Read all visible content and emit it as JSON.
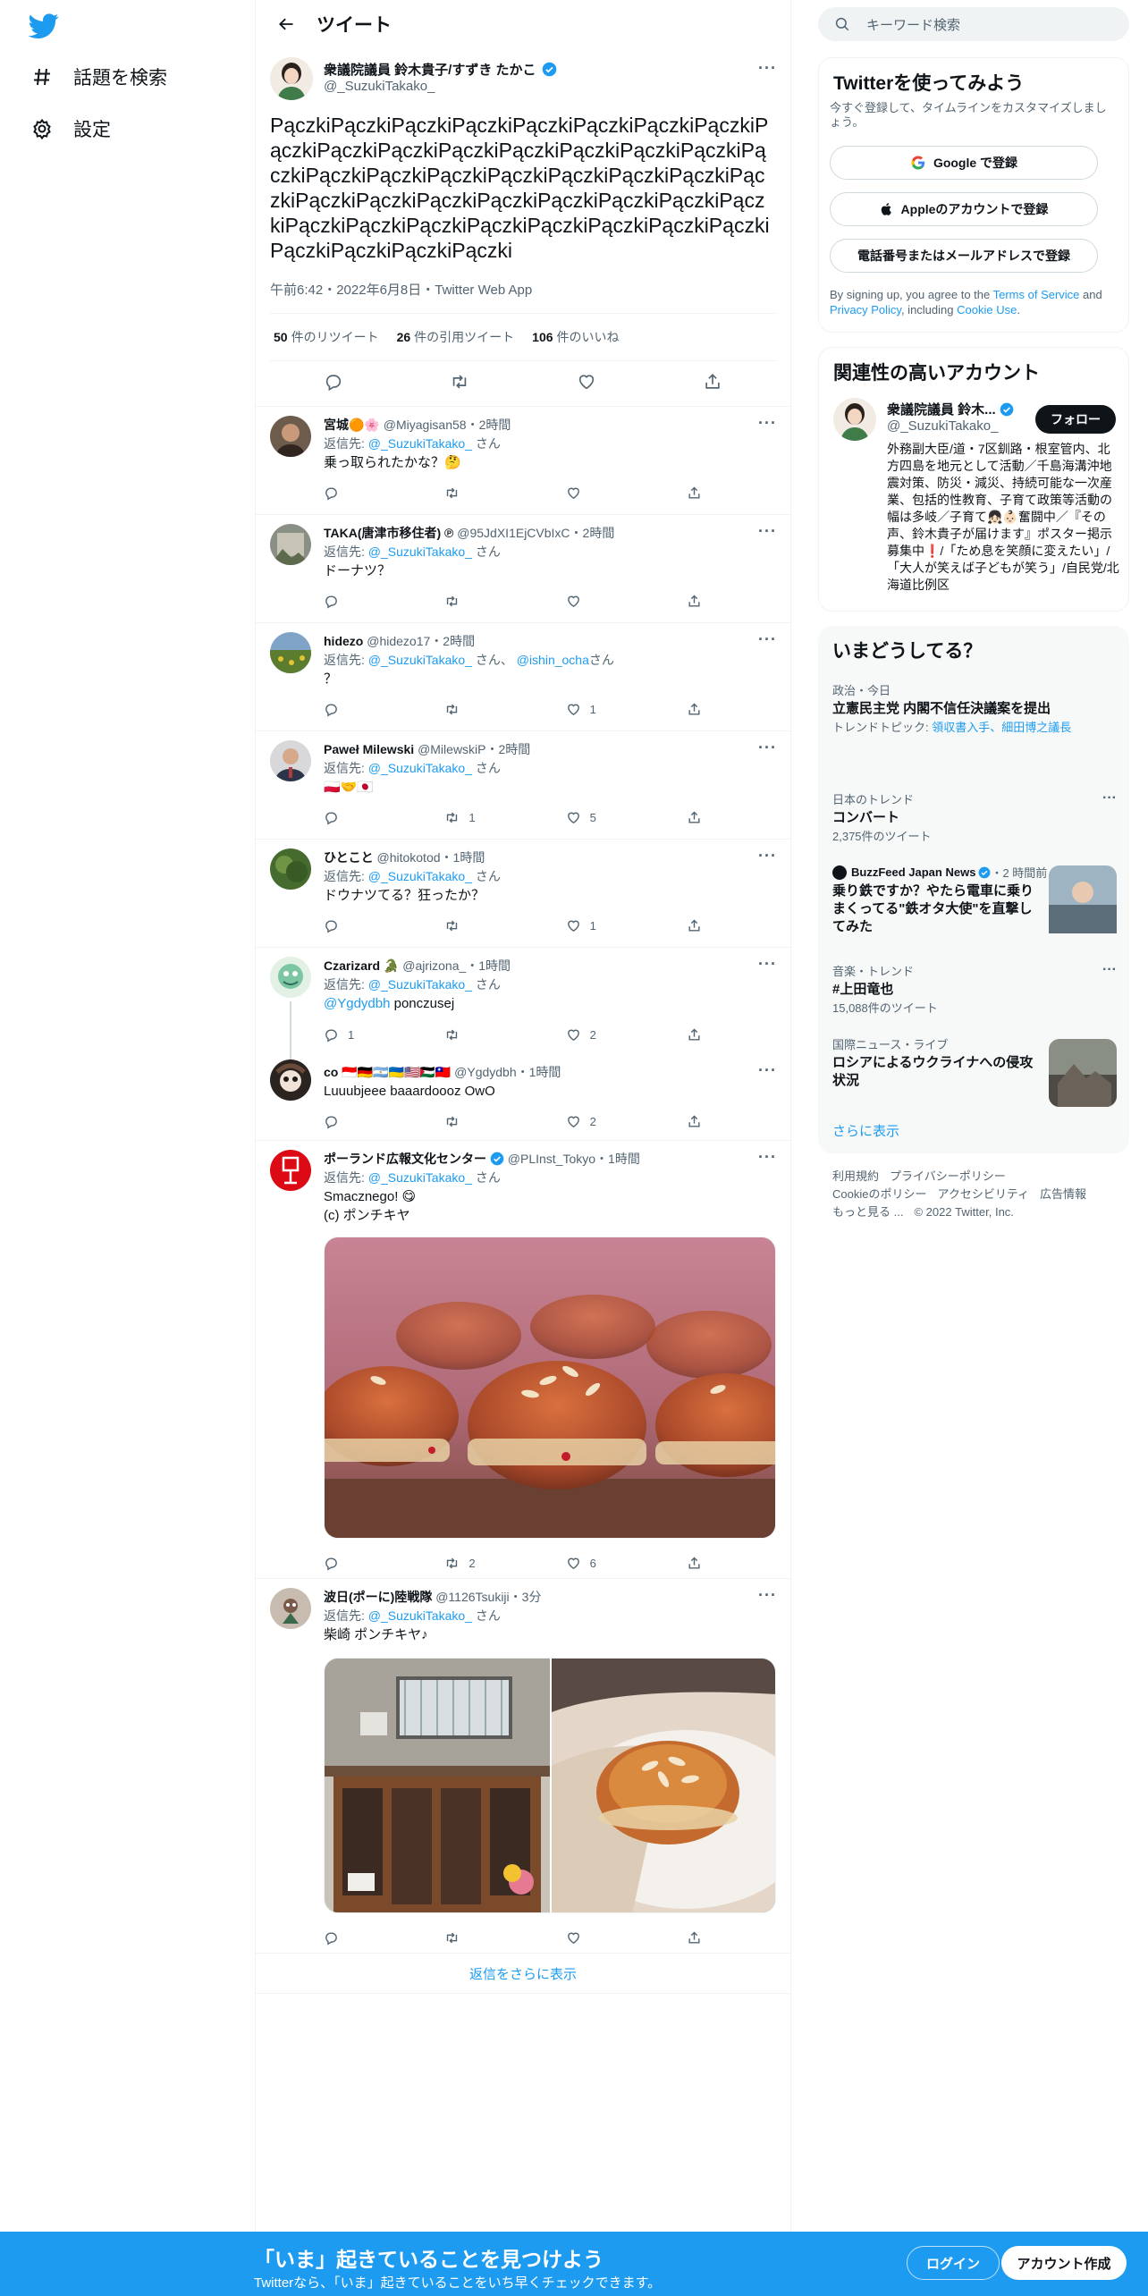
{
  "nav": {
    "items": [
      {
        "label": "話題を検索",
        "icon": "hashtag-icon"
      },
      {
        "label": "設定",
        "icon": "gear-icon"
      }
    ]
  },
  "header": {
    "title": "ツイート"
  },
  "main_tweet": {
    "name": "衆議院議員 鈴木貴子/すずき たかこ",
    "handle": "@_SuzukiTakako_",
    "text": "PączkiPączkiPączkiPączkiPączkiPączkiPączkiPączkiPączkiPączkiPączkiPączkiPączkiPączkiPączkiPączkiPączkiPączkiPączkiPączkiPączkiPączkiPączkiPączkiPączkiPączkiPączkiPączkiPączkiPączkiPączkiPączkiPączkiPączkiPączkiPączkiPączkiPączkiPączkiPączkiPączkiPączkiPączkiPączkiPączki",
    "meta": "午前6:42・2022年6月8日・Twitter Web App",
    "retweets": "50",
    "retweets_label": "件のリツイート",
    "quotes": "26",
    "quotes_label": "件の引用ツイート",
    "likes": "106",
    "likes_label": "件のいいね"
  },
  "replies": [
    {
      "name": "宮城🟠🌸",
      "handle": "@Miyagisan58",
      "time": "・2時間",
      "reply_to_label": "返信先:",
      "reply_to": "@_SuzukiTakako_",
      "reply_suffix": "さん",
      "text": "乗っ取られたかな？🤔",
      "replies": "",
      "retweets": "",
      "likes": ""
    },
    {
      "name": "TAKA(唐津市移住者) ℗",
      "handle": "@95JdXI1EjCVbIxC",
      "time": "・2時間",
      "reply_to_label": "返信先:",
      "reply_to": "@_SuzukiTakako_",
      "reply_suffix": "さん",
      "text": "ドーナツ？",
      "replies": "",
      "retweets": "",
      "likes": ""
    },
    {
      "name": "hidezo",
      "handle": "@hidezo17",
      "time": "・2時間",
      "reply_to_label": "返信先:",
      "reply_to": "@_SuzukiTakako_",
      "reply_suffix": "さん、",
      "reply_to2": "@ishin_ocha",
      "reply_suffix2": "さん",
      "text": "？",
      "replies": "",
      "retweets": "",
      "likes": "1"
    },
    {
      "name": "Paweł Milewski",
      "handle": "@MilewskiP",
      "time": "・2時間",
      "reply_to_label": "返信先:",
      "reply_to": "@_SuzukiTakako_",
      "reply_suffix": "さん",
      "text": "🇵🇱🤝🇯🇵",
      "replies": "",
      "retweets": "1",
      "likes": "5"
    },
    {
      "name": "ひとこと",
      "handle": "@hitokotod",
      "time": "・1時間",
      "reply_to_label": "返信先:",
      "reply_to": "@_SuzukiTakako_",
      "reply_suffix": "さん",
      "text": "ドウナツてる？狂ったか？",
      "replies": "",
      "retweets": "",
      "likes": "1"
    },
    {
      "name": "Czarizard 🐊",
      "handle": "@ajrizona_",
      "time": "・1時間",
      "reply_to_label": "返信先:",
      "reply_to": "@_SuzukiTakako_",
      "reply_suffix": "さん",
      "mention": "@Ygdydbh",
      "text": "ponczusej",
      "replies": "1",
      "retweets": "",
      "likes": "2"
    },
    {
      "name": "co 🇮🇩🇩🇪🇦🇷🇺🇦🇺🇸🇵🇸🇹🇼",
      "handle": "@Ygdydbh",
      "time": "・1時間",
      "text": "Luuubjeee baaardoooz OwO",
      "replies": "",
      "retweets": "",
      "likes": "2"
    },
    {
      "name": "ポーランド広報文化センター",
      "handle": "@PLInst_Tokyo",
      "time": "・1時間",
      "reply_to_label": "返信先:",
      "reply_to": "@_SuzukiTakako_",
      "reply_suffix": "さん",
      "text": "Smacznego! 😋",
      "text2": "(c) ポンチキヤ",
      "replies": "",
      "retweets": "2",
      "likes": "6"
    },
    {
      "name": "波日(ポーに)陸戦隊",
      "handle": "@1126Tsukiji",
      "time": "・3分",
      "reply_to_label": "返信先:",
      "reply_to": "@_SuzukiTakako_",
      "reply_suffix": "さん",
      "text": "柴崎 ポンチキヤ♪",
      "replies": "",
      "retweets": "",
      "likes": ""
    }
  ],
  "show_more": "返信をさらに表示",
  "search": {
    "placeholder": "キーワード検索"
  },
  "signup_card": {
    "title": "Twitterを使ってみよう",
    "subtitle": "今すぐ登録して、タイムラインをカスタマイズしましょう。",
    "google": "Google で登録",
    "apple": "Appleのアカウントで登録",
    "phone": "電話番号またはメールアドレスで登録",
    "terms_prefix": "By signing up, you agree to the ",
    "terms_link": "Terms of Service",
    "terms_and": " and ",
    "privacy_link": "Privacy Policy",
    "terms_including": ", including ",
    "cookie_link": "Cookie Use",
    "terms_end": "."
  },
  "related": {
    "title": "関連性の高いアカウント",
    "name": "衆議院議員 鈴木...",
    "handle": "@_SuzukiTakako_",
    "follow": "フォロー",
    "bio": "外務副大臣/道・7区釧路・根室管内、北方四島を地元として活動／千島海溝沖地震対策、防災・減災、持続可能な一次産業、包括的性教育、子育て政策等活動の幅は多岐／子育て👧🏻👶🏻奮闘中／『その声、鈴木貴子が届けます』ポスター掲示募集中❗️/「ため息を笑顔に変えたい」/「大人が笑えば子どもが笑う」/自民党/北海道比例区"
  },
  "trends": {
    "title": "いまどうしてる？",
    "items": [
      {
        "meta": "政治・今日",
        "title": "立憲民主党 内閣不信任決議案を提出",
        "sub_prefix": "トレンドトピック: ",
        "sub_link": "領収書入手、細田博之議長"
      },
      {
        "meta": "日本のトレンド",
        "title": "コンバート",
        "sub": "2,375件のツイート"
      },
      {
        "meta": "BuzzFeed Japan News",
        "meta_time": "・2 時間前",
        "title": "乗り鉄ですか？やたら電車に乗りまくってる\"鉄オタ大使\"を直撃してみた"
      },
      {
        "meta": "音楽・トレンド",
        "title": "#上田竜也",
        "sub": "15,088件のツイート"
      },
      {
        "meta": "国際ニュース・ライブ",
        "title": "ロシアによるウクライナへの侵攻状況"
      }
    ],
    "show_more": "さらに表示"
  },
  "footer": {
    "line1": [
      "利用規約",
      "プライバシーポリシー"
    ],
    "line2": [
      "Cookieのポリシー",
      "アクセシビリティ",
      "広告情報"
    ],
    "more": "もっと見る ...",
    "copyright": "© 2022 Twitter, Inc."
  },
  "bottom_bar": {
    "title": "「いま」起きていることを見つけよう",
    "subtitle": "Twitterなら、「いま」起きていることをいち早くチェックできます。",
    "login": "ログイン",
    "signup": "アカウント作成"
  },
  "colors": {
    "accent": "#1d9bf0",
    "text": "#0f1419",
    "secondary": "#536471",
    "border": "#eff3f4"
  }
}
